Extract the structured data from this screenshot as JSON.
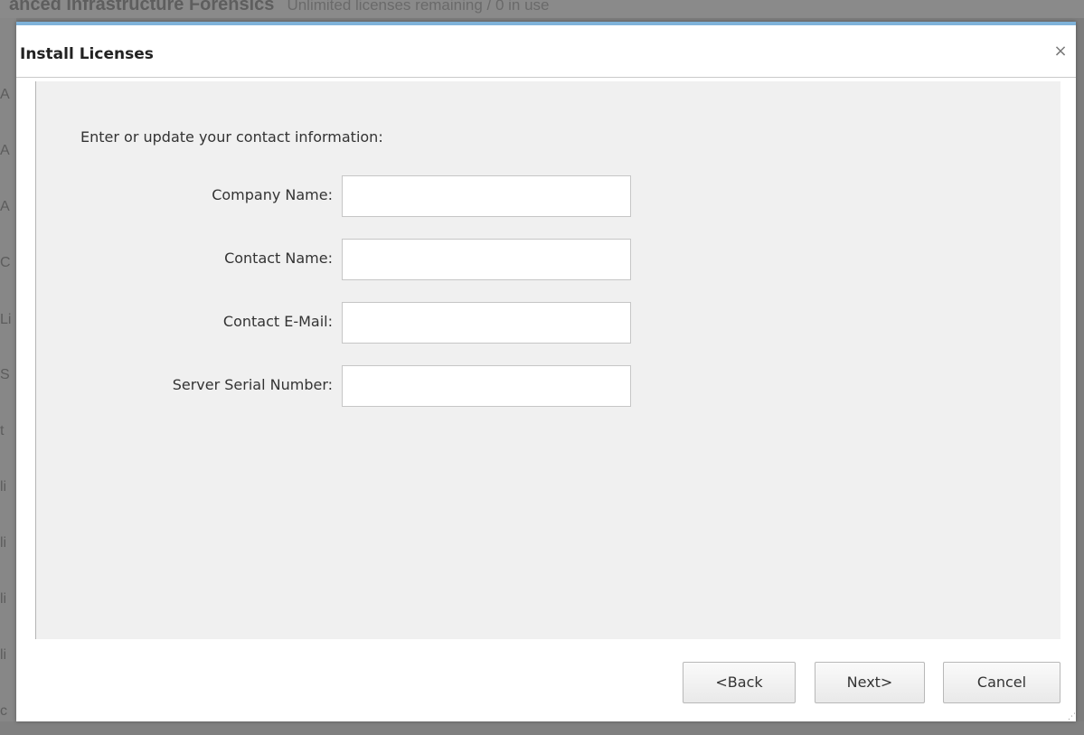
{
  "background": {
    "title": "anced Infrastructure Forensics",
    "subtitle": "Unlimited licenses remaining / 0 in use",
    "left_letters": [
      "A",
      "A",
      "A",
      "C",
      "Li",
      "S",
      "t",
      "li",
      "li",
      "li",
      "li",
      "c"
    ]
  },
  "dialog": {
    "title": "Install Licenses",
    "close_glyph": "×",
    "instruction": "Enter or update your contact information:",
    "fields": [
      {
        "label": "Company Name:",
        "value": ""
      },
      {
        "label": "Contact Name:",
        "value": ""
      },
      {
        "label": "Contact E-Mail:",
        "value": ""
      },
      {
        "label": "Server Serial Number:",
        "value": ""
      }
    ],
    "buttons": {
      "back": "<Back",
      "next": "Next>",
      "cancel": "Cancel"
    }
  },
  "colors": {
    "dialog_accent": "#7fb2d9",
    "panel_bg": "#f0f0f0"
  }
}
